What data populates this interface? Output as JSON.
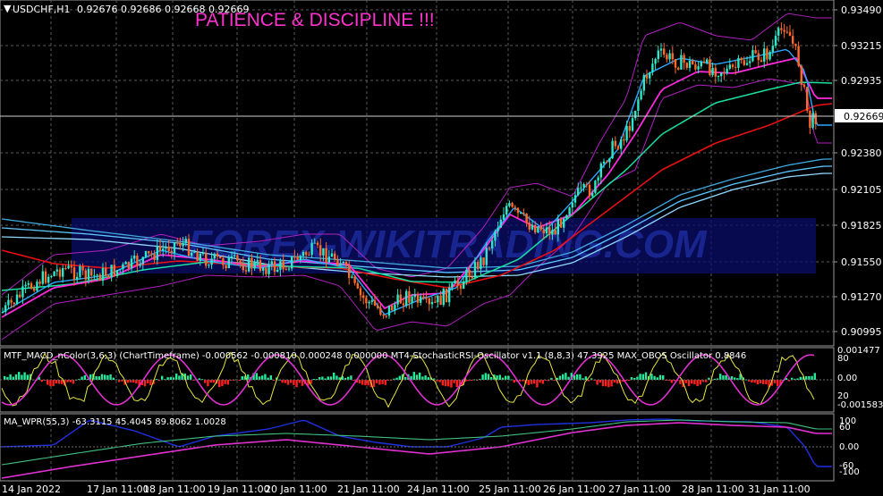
{
  "header": {
    "symbol": "USDCHF,H1",
    "ohlc": "0.92676 0.92686 0.92668 0.92669",
    "banner": "PATIENCE & DISCIPLINE !!!"
  },
  "watermark": "FOREX-WIKITRADING.COM",
  "colors": {
    "bull": "#2ee6c8",
    "bear": "#ff6a2a",
    "banner": "#ff33cc",
    "ma_red": "#e81010",
    "ma_green": "#19e0a0",
    "ma_magenta": "#ff2adf",
    "ma_blue": "#2aa7ff",
    "band": "#b020c0"
  },
  "price_axis": {
    "labels": [
      "0.93490",
      "0.93215",
      "0.92935",
      "0.92669",
      "0.92380",
      "0.92105",
      "0.91825",
      "0.91550",
      "0.91270",
      "0.90995"
    ],
    "current_price": "0.92669"
  },
  "time_axis": {
    "labels": [
      "14 Jan 2022",
      "17 Jan 11:00",
      "18 Jan 11:00",
      "19 Jan 11:00",
      "20 Jan 11:00",
      "21 Jan 11:00",
      "24 Jan 11:00",
      "25 Jan 11:00",
      "26 Jan 11:00",
      "27 Jan 11:00",
      "28 Jan 11:00",
      "31 Jan 11:00"
    ]
  },
  "indicator1": {
    "caption": "MTF_MACD_nColor(3,6,3) (ChartTimeframe) -0.000562 -0.000810 0.000248 0.000000  MT4-StochasticRSI-Oscillator v1.1 (8,8,3) 47.3925  MAX_OBOS Oscillator 0.8846",
    "axis_labels": [
      "0.001477",
      "80",
      "0.00",
      "20",
      "-0.001583"
    ]
  },
  "indicator2": {
    "caption": "MA_WPR(55,3) -63.3115 45.4045 89.8062 1.0028",
    "axis_labels": [
      "100",
      "60",
      "0.00",
      "-60",
      "-100"
    ]
  }
}
